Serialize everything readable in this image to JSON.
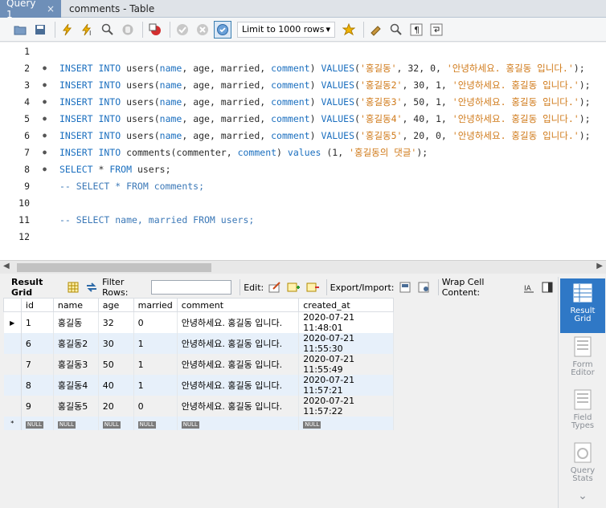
{
  "tabs": {
    "active": "Query 1",
    "inactive": "comments - Table",
    "close": "×"
  },
  "toolbar": {
    "limit": "Limit to 1000 rows"
  },
  "editor": {
    "lines": [
      {
        "n": "1",
        "tokens": []
      },
      {
        "n": "2",
        "tokens": [
          {
            "t": "INSERT INTO ",
            "c": "kw"
          },
          {
            "t": "users(",
            "c": "code"
          },
          {
            "t": "name",
            "c": "kw"
          },
          {
            "t": ", age, married, ",
            "c": "code"
          },
          {
            "t": "comment",
            "c": "kw"
          },
          {
            "t": ") ",
            "c": "code"
          },
          {
            "t": "VALUES",
            "c": "kw"
          },
          {
            "t": "(",
            "c": "code"
          },
          {
            "t": "'홍길동'",
            "c": "str"
          },
          {
            "t": ", 32, 0, ",
            "c": "code"
          },
          {
            "t": "'안녕하세요. 홍길동 입니다.'",
            "c": "str"
          },
          {
            "t": ");",
            "c": "code"
          }
        ]
      },
      {
        "n": "3",
        "tokens": [
          {
            "t": "INSERT INTO ",
            "c": "kw"
          },
          {
            "t": "users(",
            "c": "code"
          },
          {
            "t": "name",
            "c": "kw"
          },
          {
            "t": ", age, married, ",
            "c": "code"
          },
          {
            "t": "comment",
            "c": "kw"
          },
          {
            "t": ") ",
            "c": "code"
          },
          {
            "t": "VALUES",
            "c": "kw"
          },
          {
            "t": "(",
            "c": "code"
          },
          {
            "t": "'홍길동2'",
            "c": "str"
          },
          {
            "t": ", 30, 1, ",
            "c": "code"
          },
          {
            "t": "'안녕하세요. 홍길동 입니다.'",
            "c": "str"
          },
          {
            "t": ");",
            "c": "code"
          }
        ]
      },
      {
        "n": "4",
        "tokens": [
          {
            "t": "INSERT INTO ",
            "c": "kw"
          },
          {
            "t": "users(",
            "c": "code"
          },
          {
            "t": "name",
            "c": "kw"
          },
          {
            "t": ", age, married, ",
            "c": "code"
          },
          {
            "t": "comment",
            "c": "kw"
          },
          {
            "t": ") ",
            "c": "code"
          },
          {
            "t": "VALUES",
            "c": "kw"
          },
          {
            "t": "(",
            "c": "code"
          },
          {
            "t": "'홍길동3'",
            "c": "str"
          },
          {
            "t": ", 50, 1, ",
            "c": "code"
          },
          {
            "t": "'안녕하세요. 홍길동 입니다.'",
            "c": "str"
          },
          {
            "t": ");",
            "c": "code"
          }
        ]
      },
      {
        "n": "5",
        "tokens": [
          {
            "t": "INSERT INTO ",
            "c": "kw"
          },
          {
            "t": "users(",
            "c": "code"
          },
          {
            "t": "name",
            "c": "kw"
          },
          {
            "t": ", age, married, ",
            "c": "code"
          },
          {
            "t": "comment",
            "c": "kw"
          },
          {
            "t": ") ",
            "c": "code"
          },
          {
            "t": "VALUES",
            "c": "kw"
          },
          {
            "t": "(",
            "c": "code"
          },
          {
            "t": "'홍길동4'",
            "c": "str"
          },
          {
            "t": ", 40, 1, ",
            "c": "code"
          },
          {
            "t": "'안녕하세요. 홍길동 입니다.'",
            "c": "str"
          },
          {
            "t": ");",
            "c": "code"
          }
        ]
      },
      {
        "n": "6",
        "tokens": [
          {
            "t": "INSERT INTO ",
            "c": "kw"
          },
          {
            "t": "users(",
            "c": "code"
          },
          {
            "t": "name",
            "c": "kw"
          },
          {
            "t": ", age, married, ",
            "c": "code"
          },
          {
            "t": "comment",
            "c": "kw"
          },
          {
            "t": ") ",
            "c": "code"
          },
          {
            "t": "VALUES",
            "c": "kw"
          },
          {
            "t": "(",
            "c": "code"
          },
          {
            "t": "'홍길동5'",
            "c": "str"
          },
          {
            "t": ", 20, 0, ",
            "c": "code"
          },
          {
            "t": "'안녕하세요. 홍길동 입니다.'",
            "c": "str"
          },
          {
            "t": ");",
            "c": "code"
          }
        ]
      },
      {
        "n": "7",
        "tokens": [
          {
            "t": "INSERT INTO ",
            "c": "kw"
          },
          {
            "t": "comments(commenter, ",
            "c": "code"
          },
          {
            "t": "comment",
            "c": "kw"
          },
          {
            "t": ") ",
            "c": "code"
          },
          {
            "t": "values",
            "c": "kw"
          },
          {
            "t": " (1, ",
            "c": "code"
          },
          {
            "t": "'홍길동의 댓글'",
            "c": "str"
          },
          {
            "t": ");",
            "c": "code"
          }
        ]
      },
      {
        "n": "8",
        "tokens": [
          {
            "t": "SELECT",
            "c": "kw"
          },
          {
            "t": " * ",
            "c": "code"
          },
          {
            "t": "FROM",
            "c": "kw"
          },
          {
            "t": " users;",
            "c": "code"
          }
        ]
      },
      {
        "n": "9",
        "tokens": [
          {
            "t": "-- SELECT * FROM comments;",
            "c": "cm"
          }
        ]
      },
      {
        "n": "10",
        "tokens": []
      },
      {
        "n": "11",
        "tokens": [
          {
            "t": "-- SELECT name, married FROM users;",
            "c": "cm"
          }
        ]
      },
      {
        "n": "12",
        "tokens": []
      }
    ]
  },
  "resultbar": {
    "result_grid": "Result Grid",
    "filter_rows": "Filter Rows:",
    "edit": "Edit:",
    "export_import": "Export/Import:",
    "wrap": "Wrap Cell Content:"
  },
  "grid": {
    "columns": [
      "id",
      "name",
      "age",
      "married",
      "comment",
      "created_at"
    ],
    "rows": [
      [
        "1",
        "홍길동",
        "32",
        "0",
        "안녕하세요. 홍길동 입니다.",
        "2020-07-21 11:48:01"
      ],
      [
        "6",
        "홍길동2",
        "30",
        "1",
        "안녕하세요. 홍길동 입니다.",
        "2020-07-21 11:55:30"
      ],
      [
        "7",
        "홍길동3",
        "50",
        "1",
        "안녕하세요. 홍길동 입니다.",
        "2020-07-21 11:55:49"
      ],
      [
        "8",
        "홍길동4",
        "40",
        "1",
        "안녕하세요. 홍길동 입니다.",
        "2020-07-21 11:57:21"
      ],
      [
        "9",
        "홍길동5",
        "20",
        "0",
        "안녕하세요. 홍길동 입니다.",
        "2020-07-21 11:57:22"
      ]
    ],
    "null_label": "NULL",
    "new_row_marker": "*",
    "current_row_marker": "▶"
  },
  "side": {
    "result_grid": "Result\nGrid",
    "form_editor": "Form\nEditor",
    "field_types": "Field\nTypes",
    "query_stats": "Query\nStats"
  }
}
